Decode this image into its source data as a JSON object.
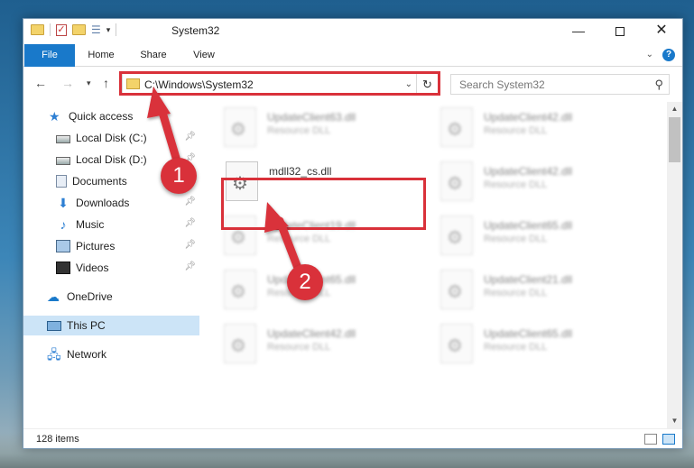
{
  "window": {
    "title": "System32",
    "minimize_icon": "—",
    "close_icon": "✕"
  },
  "ribbon": {
    "tabs": [
      "File",
      "Home",
      "Share",
      "View"
    ]
  },
  "address": {
    "path": "C:\\Windows\\System32",
    "search_placeholder": "Search System32"
  },
  "sidebar": {
    "items": [
      {
        "label": "Quick access",
        "icon": "star-icon"
      },
      {
        "label": "Local Disk (C:)",
        "icon": "disk-icon",
        "pinned": true
      },
      {
        "label": "Local Disk (D:)",
        "icon": "disk-icon",
        "pinned": true
      },
      {
        "label": "Documents",
        "icon": "documents-icon",
        "pinned": true
      },
      {
        "label": "Downloads",
        "icon": "download-icon",
        "pinned": true
      },
      {
        "label": "Music",
        "icon": "music-icon",
        "pinned": true
      },
      {
        "label": "Pictures",
        "icon": "pictures-icon",
        "pinned": true
      },
      {
        "label": "Videos",
        "icon": "videos-icon",
        "pinned": true
      },
      {
        "label": "OneDrive",
        "icon": "onedrive-icon"
      },
      {
        "label": "This PC",
        "icon": "computer-icon",
        "selected": true
      },
      {
        "label": "Network",
        "icon": "network-icon"
      }
    ]
  },
  "files": [
    {
      "name": "UpdateClient63.dll",
      "type": "Resource DLL"
    },
    {
      "name": "UpdateClient42.dll",
      "type": "Resource DLL"
    },
    {
      "name": "mdll32_cs.dll",
      "type": ""
    },
    {
      "name": "UpdateClient42.dll",
      "type": "Resource DLL"
    },
    {
      "name": "UpdateClient19.dll",
      "type": "Resource DLL"
    },
    {
      "name": "UpdateClient65.dll",
      "type": "Resource DLL"
    },
    {
      "name": "UpdateClient65.dll",
      "type": "Resource DLL"
    },
    {
      "name": "UpdateClient21.dll",
      "type": "Resource DLL"
    },
    {
      "name": "UpdateClient42.dll",
      "type": "Resource DLL"
    },
    {
      "name": "UpdateClient65.dll",
      "type": "Resource DLL"
    }
  ],
  "status": {
    "item_count": "128 items"
  },
  "callouts": {
    "step1": "1",
    "step2": "2",
    "color": "#d9313a"
  }
}
